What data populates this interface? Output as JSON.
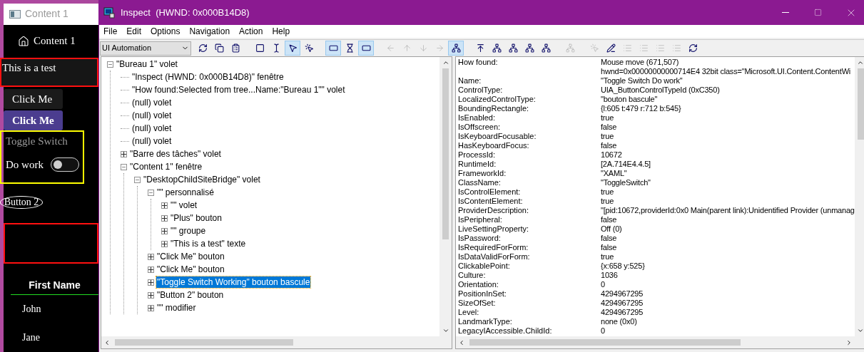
{
  "content_window": {
    "title": "Content 1",
    "nav": {
      "label": "Content 1"
    },
    "text_box": "This is a test",
    "buttons": [
      {
        "label": "Click Me",
        "kind": "plain"
      },
      {
        "label": "Click Me",
        "kind": "accent"
      }
    ],
    "toggle": {
      "header": "Toggle Switch",
      "label": "Do work",
      "on": false
    },
    "oval_button": "Button 2",
    "table": {
      "columns": [
        "First Name"
      ],
      "rows": [
        [
          "John"
        ],
        [
          "Jane"
        ]
      ]
    }
  },
  "inspect_window": {
    "title": "Inspect  (HWND: 0x000B14D8)",
    "menu": [
      "File",
      "Edit",
      "Options",
      "Navigation",
      "Action",
      "Help"
    ],
    "mode_dropdown": "UI Automation",
    "toolbar": [
      {
        "kind": "refresh",
        "pressed": false,
        "disabled": false
      },
      {
        "kind": "copy",
        "pressed": false,
        "disabled": false
      },
      {
        "kind": "properties",
        "pressed": false,
        "disabled": false
      },
      {
        "kind": "gap"
      },
      {
        "kind": "dashed-rect",
        "pressed": false,
        "disabled": false
      },
      {
        "kind": "text-cursor",
        "pressed": false,
        "disabled": false
      },
      {
        "kind": "pointer",
        "pressed": true,
        "disabled": false
      },
      {
        "kind": "hover",
        "pressed": false,
        "disabled": false
      },
      {
        "kind": "gap"
      },
      {
        "kind": "highlight-rect",
        "pressed": true,
        "disabled": false
      },
      {
        "kind": "hourglass",
        "pressed": false,
        "disabled": false
      },
      {
        "kind": "yellow-bar",
        "pressed": true,
        "disabled": false
      },
      {
        "kind": "gap"
      },
      {
        "kind": "arrow-left",
        "pressed": false,
        "disabled": true
      },
      {
        "kind": "arrow-up",
        "pressed": false,
        "disabled": true
      },
      {
        "kind": "arrow-down",
        "pressed": false,
        "disabled": true
      },
      {
        "kind": "arrow-right",
        "pressed": false,
        "disabled": true
      },
      {
        "kind": "tree",
        "pressed": true,
        "disabled": false
      },
      {
        "kind": "gap"
      },
      {
        "kind": "parent",
        "pressed": false,
        "disabled": false
      },
      {
        "kind": "first-child",
        "pressed": false,
        "disabled": false
      },
      {
        "kind": "previous",
        "pressed": false,
        "disabled": false
      },
      {
        "kind": "next",
        "pressed": false,
        "disabled": false
      },
      {
        "kind": "last-child",
        "pressed": false,
        "disabled": false
      },
      {
        "kind": "gap"
      },
      {
        "kind": "tree-grey",
        "pressed": false,
        "disabled": true
      },
      {
        "kind": "gap"
      },
      {
        "kind": "click",
        "pressed": false,
        "disabled": true
      },
      {
        "kind": "edit",
        "pressed": false,
        "disabled": false
      },
      {
        "kind": "list",
        "pressed": false,
        "disabled": true
      },
      {
        "kind": "list",
        "pressed": false,
        "disabled": true
      },
      {
        "kind": "list",
        "pressed": false,
        "disabled": true
      },
      {
        "kind": "list",
        "pressed": false,
        "disabled": true
      },
      {
        "kind": "refresh",
        "pressed": false,
        "disabled": false
      }
    ],
    "tree": [
      {
        "label": "\"Bureau 1\" volet",
        "expanded": true,
        "selected": false,
        "children": [
          {
            "label": "\"Inspect  (HWND: 0x000B14D8)\" fenêtre",
            "selected": false
          },
          {
            "label": "\"How found:Selected from tree...Name:\"Bureau 1\"\" volet",
            "selected": false
          },
          {
            "label": "(null) volet",
            "selected": false
          },
          {
            "label": "(null) volet",
            "selected": false
          },
          {
            "label": "(null) volet",
            "selected": false
          },
          {
            "label": "(null) volet",
            "selected": false
          },
          {
            "label": "\"Barre des tâches\" volet",
            "expanded": false,
            "selected": false
          },
          {
            "label": "\"Content 1\" fenêtre",
            "expanded": true,
            "selected": false,
            "children": [
              {
                "label": "\"DesktopChildSiteBridge\" volet",
                "expanded": true,
                "selected": false,
                "children": [
                  {
                    "label": "\"\" personnalisé",
                    "expanded": true,
                    "selected": false,
                    "children": [
                      {
                        "label": "\"\" volet",
                        "expanded": false,
                        "selected": false
                      },
                      {
                        "label": "\"Plus\" bouton",
                        "expanded": false,
                        "selected": false
                      },
                      {
                        "label": "\"\" groupe",
                        "expanded": false,
                        "selected": false
                      },
                      {
                        "label": "\"This is a test\" texte",
                        "expanded": false,
                        "selected": false
                      }
                    ]
                  },
                  {
                    "label": "\"Click Me\" bouton",
                    "expanded": false,
                    "selected": false
                  },
                  {
                    "label": "\"Click Me\" bouton",
                    "expanded": false,
                    "selected": false
                  },
                  {
                    "label": "\"Toggle Switch Working\" bouton bascule",
                    "expanded": false,
                    "selected": true
                  },
                  {
                    "label": "\"Button 2\" bouton",
                    "expanded": false,
                    "selected": false
                  },
                  {
                    "label": "\"\" modifier",
                    "expanded": false,
                    "selected": false
                  }
                ]
              }
            ]
          }
        ]
      }
    ],
    "properties": [
      {
        "name": "How found:",
        "value": "Mouse move (671,507)"
      },
      {
        "value": "hwnd=0x00000000000714E4 32bit class=\"Microsoft.UI.Content.ContentWi"
      },
      {
        "name": "Name:",
        "value": "\"Toggle Switch Do work\""
      },
      {
        "name": "ControlType:",
        "value": "UIA_ButtonControlTypeId (0xC350)"
      },
      {
        "name": "LocalizedControlType:",
        "value": "\"bouton bascule\""
      },
      {
        "name": "BoundingRectangle:",
        "value": "{l:605 t:479 r:712 b:545}"
      },
      {
        "name": "IsEnabled:",
        "value": "true"
      },
      {
        "name": "IsOffscreen:",
        "value": "false"
      },
      {
        "name": "IsKeyboardFocusable:",
        "value": "true"
      },
      {
        "name": "HasKeyboardFocus:",
        "value": "false"
      },
      {
        "name": "ProcessId:",
        "value": "10672"
      },
      {
        "name": "RuntimeId:",
        "value": "[2A.714E4.4.5]"
      },
      {
        "name": "FrameworkId:",
        "value": "\"XAML\""
      },
      {
        "name": "ClassName:",
        "value": "\"ToggleSwitch\""
      },
      {
        "name": "IsControlElement:",
        "value": "true"
      },
      {
        "name": "IsContentElement:",
        "value": "true"
      },
      {
        "name": "ProviderDescription:",
        "value": "\"[pid:10672,providerId:0x0 Main(parent link):Unidentified Provider (unmanag"
      },
      {
        "name": "IsPeripheral:",
        "value": "false"
      },
      {
        "name": "LiveSettingProperty:",
        "value": "Off (0)"
      },
      {
        "name": "IsPassword:",
        "value": "false"
      },
      {
        "name": "IsRequiredForForm:",
        "value": "false"
      },
      {
        "name": "IsDataValidForForm:",
        "value": "true"
      },
      {
        "name": "ClickablePoint:",
        "value": "{x:658 y:525}"
      },
      {
        "name": "Culture:",
        "value": "1036"
      },
      {
        "name": "Orientation:",
        "value": "0"
      },
      {
        "name": "PositionInSet:",
        "value": "4294967295"
      },
      {
        "name": "SizeOfSet:",
        "value": "4294967295"
      },
      {
        "name": "Level:",
        "value": "4294967295"
      },
      {
        "name": "LandmarkType:",
        "value": "none (0x0)"
      },
      {
        "name": "LegacyIAccessible.ChildId:",
        "value": "0"
      }
    ]
  }
}
